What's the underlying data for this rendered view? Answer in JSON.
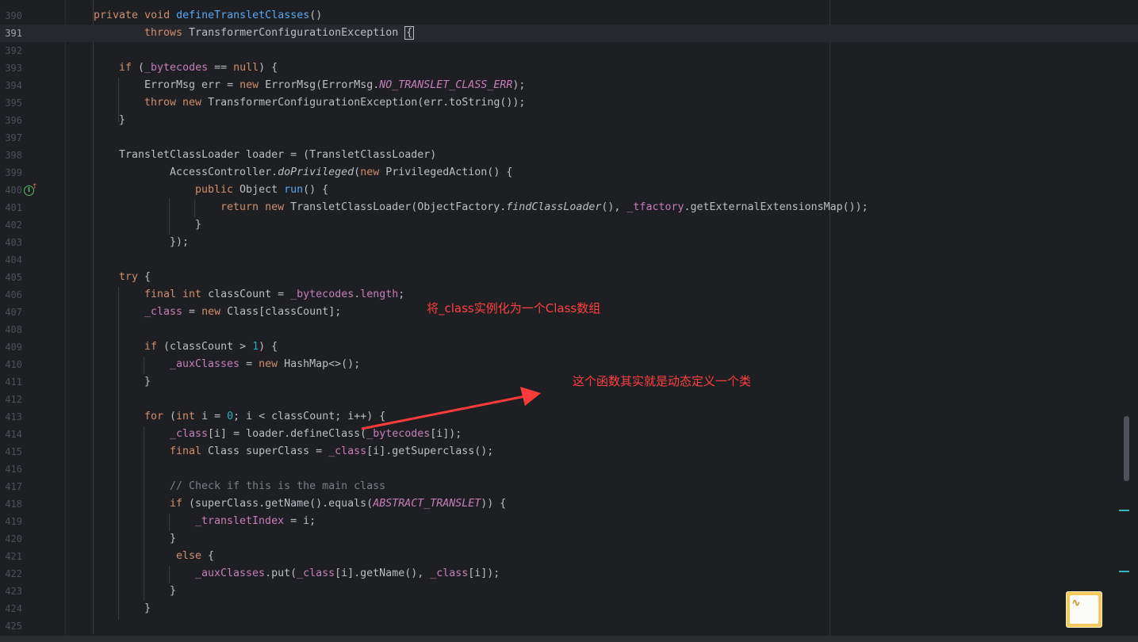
{
  "editor": {
    "current_line": "391",
    "lines": [
      {
        "n": "390",
        "t": "private void defineTransletClasses()"
      },
      {
        "n": "391",
        "t": "throws TransformerConfigurationException {"
      },
      {
        "n": "392",
        "t": ""
      },
      {
        "n": "393",
        "t": "if (_bytecodes == null) {"
      },
      {
        "n": "394",
        "t": "ErrorMsg err = new ErrorMsg(ErrorMsg.NO_TRANSLET_CLASS_ERR);"
      },
      {
        "n": "395",
        "t": "throw new TransformerConfigurationException(err.toString());"
      },
      {
        "n": "396",
        "t": "}"
      },
      {
        "n": "397",
        "t": ""
      },
      {
        "n": "398",
        "t": "TransletClassLoader loader = (TransletClassLoader)"
      },
      {
        "n": "399",
        "t": "AccessController.doPrivileged(new PrivilegedAction() {"
      },
      {
        "n": "400",
        "t": "public Object run() {"
      },
      {
        "n": "401",
        "t": "return new TransletClassLoader(ObjectFactory.findClassLoader(), _tfactory.getExternalExtensionsMap());"
      },
      {
        "n": "402",
        "t": "}"
      },
      {
        "n": "403",
        "t": "});"
      },
      {
        "n": "404",
        "t": ""
      },
      {
        "n": "405",
        "t": "try {"
      },
      {
        "n": "406",
        "t": "final int classCount = _bytecodes.length;"
      },
      {
        "n": "407",
        "t": "_class = new Class[classCount];"
      },
      {
        "n": "408",
        "t": ""
      },
      {
        "n": "409",
        "t": "if (classCount > 1) {"
      },
      {
        "n": "410",
        "t": "_auxClasses = new HashMap<>();"
      },
      {
        "n": "411",
        "t": "}"
      },
      {
        "n": "412",
        "t": ""
      },
      {
        "n": "413",
        "t": "for (int i = 0; i < classCount; i++) {"
      },
      {
        "n": "414",
        "t": "_class[i] = loader.defineClass(_bytecodes[i]);"
      },
      {
        "n": "415",
        "t": "final Class superClass = _class[i].getSuperclass();"
      },
      {
        "n": "416",
        "t": ""
      },
      {
        "n": "417",
        "t": "// Check if this is the main class"
      },
      {
        "n": "418",
        "t": "if (superClass.getName().equals(ABSTRACT_TRANSLET)) {"
      },
      {
        "n": "419",
        "t": "_transletIndex = i;"
      },
      {
        "n": "420",
        "t": "}"
      },
      {
        "n": "421",
        "t": "else {"
      },
      {
        "n": "422",
        "t": "_auxClasses.put(_class[i].getName(), _class[i]);"
      },
      {
        "n": "423",
        "t": "}"
      },
      {
        "n": "424",
        "t": "}"
      },
      {
        "n": "425",
        "t": ""
      }
    ]
  },
  "annotations": {
    "note1": "将_class实例化为一个Class数组",
    "note2": "这个函数其实就是动态定义一个类",
    "arrow_color": "#ff3b3b"
  },
  "gutter": {
    "icon": "implementation-icon"
  }
}
